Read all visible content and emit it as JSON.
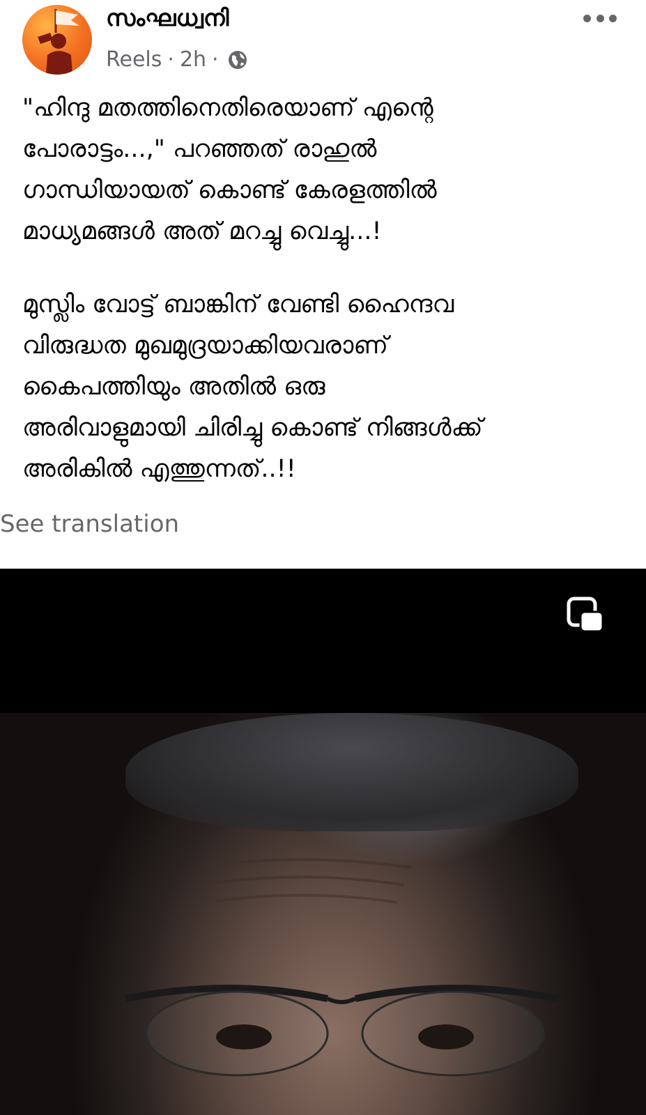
{
  "post": {
    "author": "സംഘധ്വനി",
    "type": "Reels",
    "time": "2h",
    "separator": "·",
    "caption_paragraphs": [
      "\"ഹിന്ദു മതത്തിനെതിരെയാണ് എന്റെ\nപോരാട്ടം...,\" പറഞ്ഞത് രാഹുൽ\nഗാന്ധിയായത് കൊണ്ട് കേരളത്തിൽ\nമാധ്യമങ്ങൾ അത് മറച്ചു വെച്ചു...!",
      "മുസ്ലിം വോട്ട് ബാങ്കിന് വേണ്ടി ഹൈന്ദവ\nവിരുദ്ധത മുഖമുദ്രയാക്കിയവരാണ്\nകൈപത്തിയും അതിൽ ഒരു\nഅരിവാളുമായി ചിരിച്ചു കൊണ്ട് നിങ്ങൾക്ക്\nഅരികിൽ എത്തുന്നത്..!!"
    ],
    "see_translation": "See translation"
  },
  "icons": {
    "audience": "globe-icon",
    "menu": "more-options-icon",
    "video_control": "picture-in-picture-icon"
  },
  "colors": {
    "text_primary": "#050505",
    "text_secondary": "#65676b",
    "avatar_brand": "#f37021",
    "video_background": "#000000"
  }
}
